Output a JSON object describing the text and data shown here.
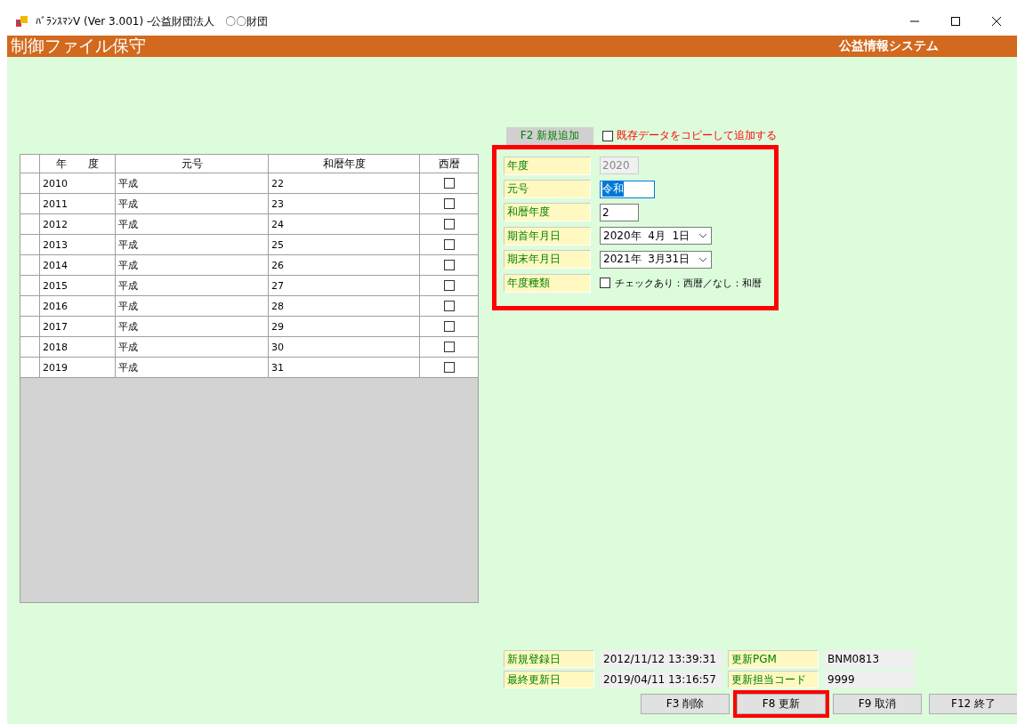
{
  "window": {
    "title": "ﾊﾞﾗﾝｽﾏﾝV (Ver 3.001) -公益財団法人　〇〇財団"
  },
  "header": {
    "title": "制御ファイル保守",
    "system": "公益情報システム"
  },
  "table": {
    "columns": [
      "年　　度",
      "元号",
      "和暦年度",
      "西暦"
    ],
    "rows": [
      {
        "year": "2010",
        "era": "平成",
        "era_year": "22",
        "western": false
      },
      {
        "year": "2011",
        "era": "平成",
        "era_year": "23",
        "western": false
      },
      {
        "year": "2012",
        "era": "平成",
        "era_year": "24",
        "western": false
      },
      {
        "year": "2013",
        "era": "平成",
        "era_year": "25",
        "western": false
      },
      {
        "year": "2014",
        "era": "平成",
        "era_year": "26",
        "western": false
      },
      {
        "year": "2015",
        "era": "平成",
        "era_year": "27",
        "western": false
      },
      {
        "year": "2016",
        "era": "平成",
        "era_year": "28",
        "western": false
      },
      {
        "year": "2017",
        "era": "平成",
        "era_year": "29",
        "western": false
      },
      {
        "year": "2018",
        "era": "平成",
        "era_year": "30",
        "western": false
      },
      {
        "year": "2019",
        "era": "平成",
        "era_year": "31",
        "western": false
      }
    ]
  },
  "form": {
    "add_button": "F2 新規追加",
    "copy": {
      "label": "既存データをコピーして追加する",
      "checked": false
    },
    "highlighted": true,
    "fields": [
      {
        "kind": "text",
        "label": "年度",
        "value": "2020",
        "disabled": true,
        "selected": false
      },
      {
        "kind": "text",
        "label": "元号",
        "value": "令和",
        "disabled": false,
        "selected": true
      },
      {
        "kind": "text",
        "label": "和暦年度",
        "value": "2",
        "disabled": false,
        "selected": false
      },
      {
        "kind": "date",
        "label": "期首年月日",
        "value": "2020年  4月  1日"
      },
      {
        "kind": "date",
        "label": "期末年月日",
        "value": "2021年  3月31日"
      },
      {
        "kind": "checkbox",
        "label": "年度種類",
        "text": "チェックあり：西暦／なし：和暦",
        "checked": false
      }
    ]
  },
  "info": [
    {
      "label": "新規登録日",
      "value": "2012/11/12 13:39:31"
    },
    {
      "label": "更新PGM",
      "value": "BNM0813"
    },
    {
      "label": "最終更新日",
      "value": "2019/04/11 13:16:57"
    },
    {
      "label": "更新担当コード",
      "value": "9999"
    }
  ],
  "buttons": [
    {
      "label": "F3 削除",
      "highlighted": false
    },
    {
      "label": "F8 更新",
      "highlighted": true
    },
    {
      "label": "F9 取消",
      "highlighted": false
    },
    {
      "label": "F12  終了",
      "highlighted": false
    }
  ]
}
